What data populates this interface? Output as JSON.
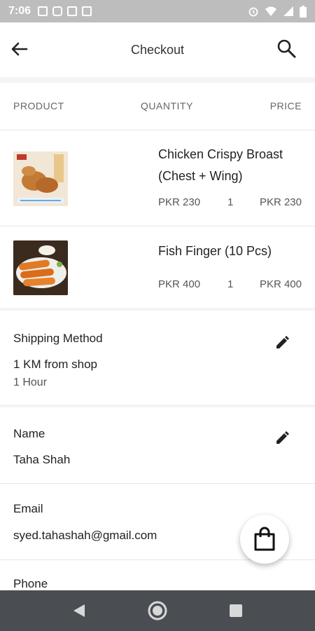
{
  "status_bar": {
    "time": "7:06"
  },
  "header": {
    "title": "Checkout",
    "back_icon": "arrow-left-icon",
    "search_icon": "search-icon"
  },
  "table_header": {
    "product": "PRODUCT",
    "quantity": "QUANTITY",
    "price": "PRICE"
  },
  "products": [
    {
      "name": "Chicken Crispy Broast (Chest + Wing)",
      "unit_price": "PKR 230",
      "quantity": "1",
      "total": "PKR 230"
    },
    {
      "name": "Fish Finger (10 Pcs)",
      "unit_price": "PKR 400",
      "quantity": "1",
      "total": "PKR 400"
    }
  ],
  "shipping": {
    "label": "Shipping Method",
    "value": "1 KM from shop",
    "sub": "1 Hour"
  },
  "name": {
    "label": "Name",
    "value": "Taha Shah"
  },
  "email": {
    "label": "Email",
    "value": "syed.tahashah@gmail.com"
  },
  "phone": {
    "label": "Phone"
  },
  "colors": {
    "status_bar": "#bdbdbd",
    "nav_bar": "#4a4d52",
    "text": "#222222",
    "muted": "#666666"
  }
}
